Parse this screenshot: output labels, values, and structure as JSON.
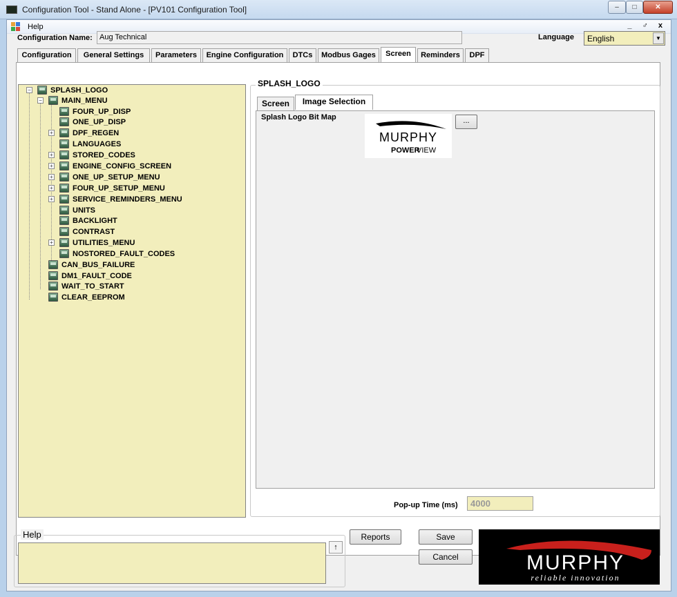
{
  "window": {
    "title": "Configuration Tool - Stand Alone - [PV101 Configuration Tool]",
    "controls": {
      "minimize": "–",
      "maximize": "□",
      "close": "✕"
    }
  },
  "menubar": {
    "items": [
      "Help"
    ],
    "mdi_controls": "_ ♂ x"
  },
  "config": {
    "name_label": "Configuration Name:",
    "name_value": "Aug Technical",
    "language_label": "Language",
    "language_value": "English"
  },
  "tabs": [
    {
      "label": "Configuration",
      "active": false
    },
    {
      "label": "General Settings",
      "active": false
    },
    {
      "label": "Parameters",
      "active": false
    },
    {
      "label": "Engine Configuration",
      "active": false
    },
    {
      "label": "DTCs",
      "active": false
    },
    {
      "label": "Modbus Gages",
      "active": false
    },
    {
      "label": "Screen",
      "active": true
    },
    {
      "label": "Reminders",
      "active": false
    },
    {
      "label": "DPF",
      "active": false
    }
  ],
  "tree": {
    "nodes": [
      {
        "label": "SPLASH_LOGO",
        "level": 0,
        "expander": "minus"
      },
      {
        "label": "MAIN_MENU",
        "level": 1,
        "expander": "minus"
      },
      {
        "label": "FOUR_UP_DISP",
        "level": 2,
        "expander": ""
      },
      {
        "label": "ONE_UP_DISP",
        "level": 2,
        "expander": ""
      },
      {
        "label": "DPF_REGEN",
        "level": 2,
        "expander": "plus"
      },
      {
        "label": "LANGUAGES",
        "level": 2,
        "expander": ""
      },
      {
        "label": "STORED_CODES",
        "level": 2,
        "expander": "plus"
      },
      {
        "label": "ENGINE_CONFIG_SCREEN",
        "level": 2,
        "expander": "plus"
      },
      {
        "label": "ONE_UP_SETUP_MENU",
        "level": 2,
        "expander": "plus"
      },
      {
        "label": "FOUR_UP_SETUP_MENU",
        "level": 2,
        "expander": "plus"
      },
      {
        "label": "SERVICE_REMINDERS_MENU",
        "level": 2,
        "expander": "plus"
      },
      {
        "label": "UNITS",
        "level": 2,
        "expander": ""
      },
      {
        "label": "BACKLIGHT",
        "level": 2,
        "expander": ""
      },
      {
        "label": "CONTRAST",
        "level": 2,
        "expander": ""
      },
      {
        "label": "UTILITIES_MENU",
        "level": 2,
        "expander": "plus"
      },
      {
        "label": "NOSTORED_FAULT_CODES",
        "level": 2,
        "expander": ""
      },
      {
        "label": "CAN_BUS_FAILURE",
        "level": 1,
        "expander": ""
      },
      {
        "label": "DM1_FAULT_CODE",
        "level": 1,
        "expander": ""
      },
      {
        "label": "WAIT_TO_START",
        "level": 1,
        "expander": ""
      },
      {
        "label": "CLEAR_EEPROM",
        "level": 1,
        "expander": ""
      }
    ]
  },
  "detail": {
    "group_title": "SPLASH_LOGO",
    "sub_tabs": [
      {
        "label": "Screen",
        "active": false
      },
      {
        "label": "Image Selection",
        "active": true
      }
    ],
    "bitmap_label": "Splash Logo Bit Map",
    "bitmap_logo": {
      "brand": "MURPHY",
      "product_bold": "POWER",
      "product_light": "VIEW"
    },
    "browse_button": "...",
    "popup_label": "Pop-up Time (ms)",
    "popup_value": "4000"
  },
  "help": {
    "title": "Help",
    "text": "",
    "scroll_icon": "↑"
  },
  "buttons": {
    "reports": "Reports",
    "save": "Save",
    "cancel": "Cancel"
  },
  "brand_logo": {
    "name": "MURPHY",
    "tagline": "reliable innovation",
    "swoosh_color": "#c8201c"
  }
}
